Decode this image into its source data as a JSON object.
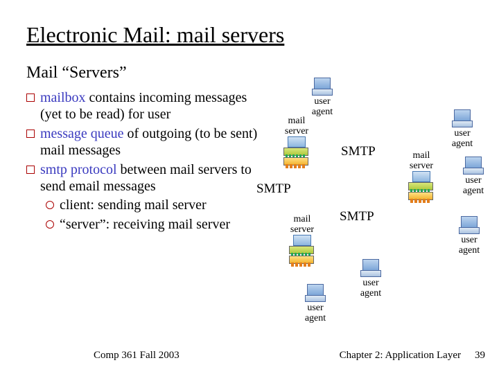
{
  "title": "Electronic Mail: mail servers",
  "subtitle": "Mail “Servers”",
  "bullets": [
    {
      "key": "mailbox",
      "rest": " contains incoming messages (yet to be read) for user"
    },
    {
      "key": "message queue",
      "rest": " of outgoing (to be sent) mail messages"
    },
    {
      "key": "smtp protocol",
      "rest": " between mail servers to send email messages"
    }
  ],
  "subbullets": [
    "client: sending mail server",
    "“server”: receiving mail server"
  ],
  "diagram": {
    "ua_label": "user\nagent",
    "ms_label": "mail\nserver",
    "smtp": "SMTP"
  },
  "footer": {
    "left": "Comp 361   Fall 2003",
    "right": "Chapter 2: Application Layer",
    "page": "39"
  }
}
